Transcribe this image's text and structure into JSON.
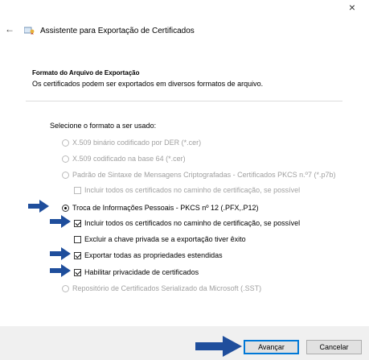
{
  "window": {
    "close_glyph": "×",
    "back_glyph": "←"
  },
  "header": {
    "title": "Assistente para Exportação de Certificados"
  },
  "section": {
    "heading": "Formato do Arquivo de Exportação",
    "description": "Os certificados podem ser exportados em diversos formatos de arquivo."
  },
  "form": {
    "prompt": "Selecione o formato a ser usado:",
    "options": [
      {
        "type": "radio",
        "label": "X.509 binário codificado por DER (*.cer)",
        "selected": false,
        "enabled": false
      },
      {
        "type": "radio",
        "label": "X.509 codificado na base 64 (*.cer)",
        "selected": false,
        "enabled": false
      },
      {
        "type": "radio",
        "label": "Padrão de Sintaxe de Mensagens Criptografadas - Certificados PKCS n.º7 (*.p7b)",
        "selected": false,
        "enabled": false
      },
      {
        "type": "checkbox",
        "label": "Incluir todos os certificados no caminho de certificação, se possível",
        "checked": false,
        "enabled": false
      },
      {
        "type": "radio",
        "label": "Troca de Informações Pessoais - PKCS nº 12 (.PFX,.P12)",
        "selected": true,
        "enabled": true
      },
      {
        "type": "checkbox",
        "label": "Incluir todos os certificados no caminho de certificação, se possível",
        "checked": true,
        "enabled": true
      },
      {
        "type": "checkbox",
        "label": "Excluir a chave privada se a exportação tiver êxito",
        "checked": false,
        "enabled": true
      },
      {
        "type": "checkbox",
        "label": "Exportar todas as propriedades estendidas",
        "checked": true,
        "enabled": true
      },
      {
        "type": "checkbox",
        "label": "Habilitar privacidade de certificados",
        "checked": true,
        "enabled": true
      },
      {
        "type": "radio",
        "label": "Repositório de Certificados Serializado da Microsoft (.SST)",
        "selected": false,
        "enabled": false
      }
    ]
  },
  "buttons": {
    "next": "Avançar",
    "cancel": "Cancelar"
  },
  "colors": {
    "accent": "#0078d7",
    "arrow": "#1f4e9c",
    "disabled_text": "#a0a0a0",
    "footer_bg": "#f0f0f0"
  }
}
